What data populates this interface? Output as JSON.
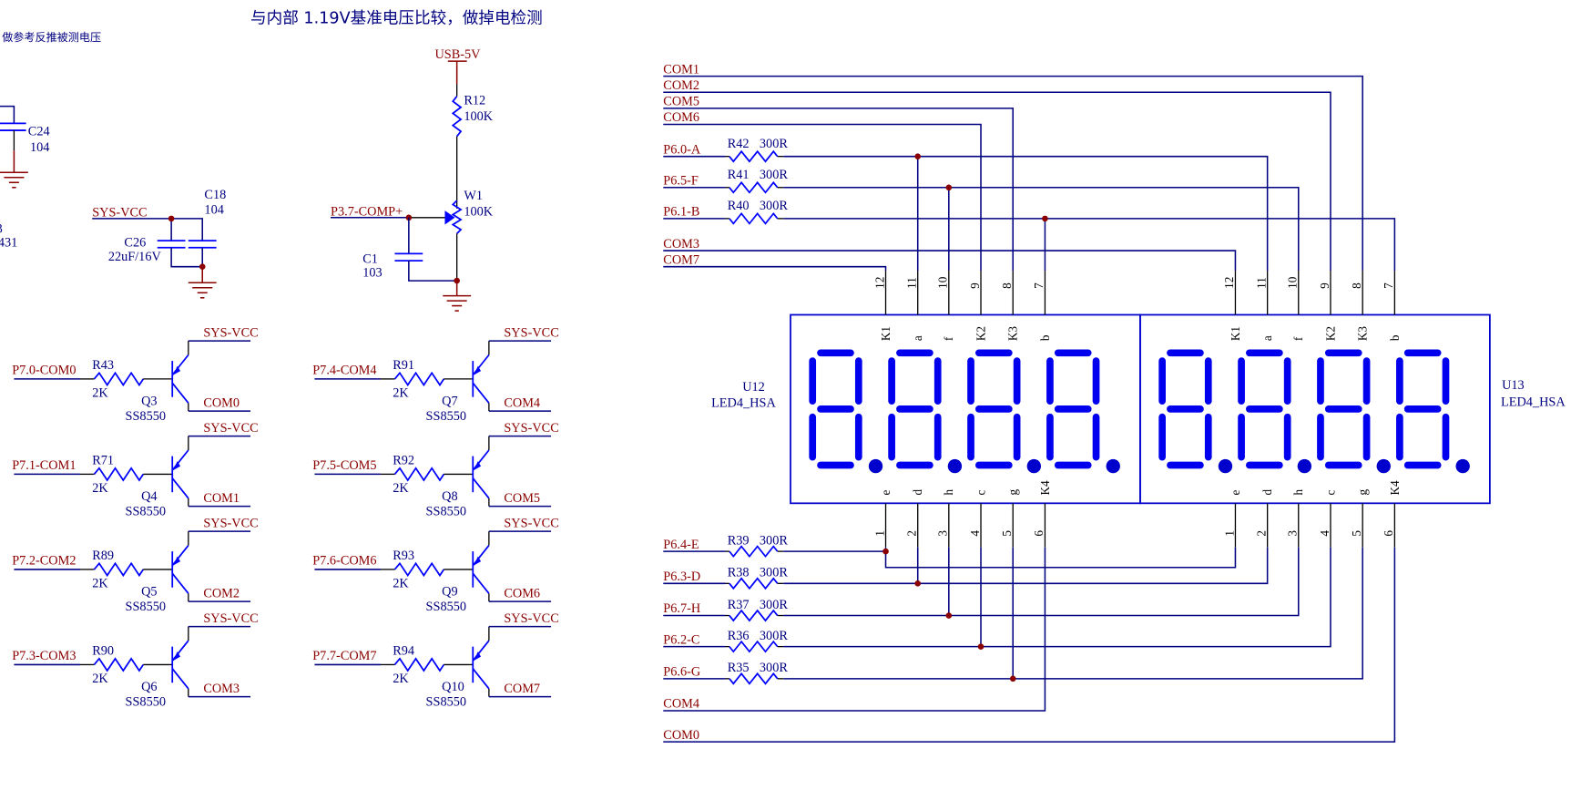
{
  "header": {
    "title": "与内部 1.19V基准电压比较，做掉电检测",
    "note": "做参考反推被测电压"
  },
  "partial_left": {
    "cap": {
      "ref": "C24",
      "value": "104"
    },
    "cut_ref_fragment": "3",
    "cut_value_fragment": "431"
  },
  "power_decoupling": {
    "net": "SYS-VCC",
    "caps": [
      {
        "ref": "C26",
        "value": "22uF/16V"
      },
      {
        "ref": "C18",
        "value": "104"
      }
    ]
  },
  "comparator_input": {
    "supply_net": "USB-5V",
    "resistor": {
      "ref": "R12",
      "value": "100K"
    },
    "pot": {
      "ref": "W1",
      "value": "100K"
    },
    "net": "P3.7-COMP+",
    "cap": {
      "ref": "C1",
      "value": "103"
    }
  },
  "drivers": [
    {
      "input": "P7.0-COM0",
      "res_ref": "R43",
      "res_val": "2K",
      "q_ref": "Q3",
      "q_part": "SS8550",
      "vcc": "SYS-VCC",
      "out": "COM0"
    },
    {
      "input": "P7.1-COM1",
      "res_ref": "R71",
      "res_val": "2K",
      "q_ref": "Q4",
      "q_part": "SS8550",
      "vcc": "SYS-VCC",
      "out": "COM1"
    },
    {
      "input": "P7.2-COM2",
      "res_ref": "R89",
      "res_val": "2K",
      "q_ref": "Q5",
      "q_part": "SS8550",
      "vcc": "SYS-VCC",
      "out": "COM2"
    },
    {
      "input": "P7.3-COM3",
      "res_ref": "R90",
      "res_val": "2K",
      "q_ref": "Q6",
      "q_part": "SS8550",
      "vcc": "SYS-VCC",
      "out": "COM3"
    },
    {
      "input": "P7.4-COM4",
      "res_ref": "R91",
      "res_val": "2K",
      "q_ref": "Q7",
      "q_part": "SS8550",
      "vcc": "SYS-VCC",
      "out": "COM4"
    },
    {
      "input": "P7.5-COM5",
      "res_ref": "R92",
      "res_val": "2K",
      "q_ref": "Q8",
      "q_part": "SS8550",
      "vcc": "SYS-VCC",
      "out": "COM5"
    },
    {
      "input": "P7.6-COM6",
      "res_ref": "R93",
      "res_val": "2K",
      "q_ref": "Q9",
      "q_part": "SS8550",
      "vcc": "SYS-VCC",
      "out": "COM6"
    },
    {
      "input": "P7.7-COM7",
      "res_ref": "R94",
      "res_val": "2K",
      "q_ref": "Q10",
      "q_part": "SS8550",
      "vcc": "SYS-VCC",
      "out": "COM7"
    }
  ],
  "display": {
    "top_nets": [
      "COM1",
      "COM2",
      "COM5",
      "COM6",
      "P6.0-A",
      "P6.5-F",
      "P6.1-B",
      "COM3",
      "COM7"
    ],
    "top_resistors": [
      {
        "net": "P6.0-A",
        "ref": "R42",
        "value": "300R"
      },
      {
        "net": "P6.5-F",
        "ref": "R41",
        "value": "300R"
      },
      {
        "net": "P6.1-B",
        "ref": "R40",
        "value": "300R"
      }
    ],
    "bottom_nets": [
      "P6.4-E",
      "P6.3-D",
      "P6.7-H",
      "P6.2-C",
      "P6.6-G",
      "COM4",
      "COM0"
    ],
    "bottom_resistors": [
      {
        "net": "P6.4-E",
        "ref": "R39",
        "value": "300R"
      },
      {
        "net": "P6.3-D",
        "ref": "R38",
        "value": "300R"
      },
      {
        "net": "P6.7-H",
        "ref": "R37",
        "value": "300R"
      },
      {
        "net": "P6.2-C",
        "ref": "R36",
        "value": "300R"
      },
      {
        "net": "P6.6-G",
        "ref": "R35",
        "value": "300R"
      }
    ],
    "modules": [
      {
        "ref": "U12",
        "part": "LED4_HSA"
      },
      {
        "ref": "U13",
        "part": "LED4_HSA"
      }
    ],
    "top_pins": [
      {
        "num": "12",
        "name": "K1"
      },
      {
        "num": "11",
        "name": "a"
      },
      {
        "num": "10",
        "name": "f"
      },
      {
        "num": "9",
        "name": "K2"
      },
      {
        "num": "8",
        "name": "K3"
      },
      {
        "num": "7",
        "name": "b"
      }
    ],
    "bottom_pins": [
      {
        "num": "1",
        "name": "e"
      },
      {
        "num": "2",
        "name": "d"
      },
      {
        "num": "3",
        "name": "h"
      },
      {
        "num": "4",
        "name": "c"
      },
      {
        "num": "5",
        "name": "g"
      },
      {
        "num": "6",
        "name": "K4"
      }
    ],
    "digits_per_module": 4
  }
}
